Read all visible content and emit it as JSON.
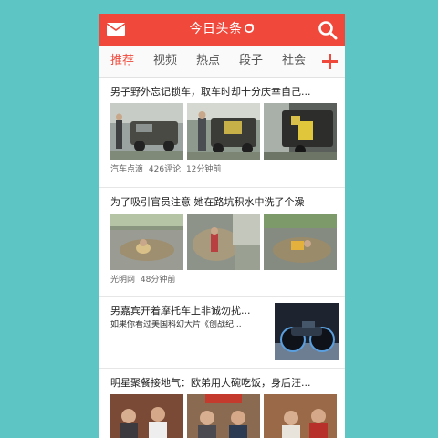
{
  "header": {
    "title": "今日头条",
    "mail_icon": "mail-icon",
    "refresh_icon": "refresh-icon",
    "search_icon": "search-icon",
    "color": "#f0483a"
  },
  "tabs": [
    {
      "label": "推荐",
      "active": true
    },
    {
      "label": "视频",
      "active": false
    },
    {
      "label": "热点",
      "active": false
    },
    {
      "label": "段子",
      "active": false
    },
    {
      "label": "社会",
      "active": false
    }
  ],
  "add_channel_icon": "plus-icon",
  "feed": [
    {
      "title": "男子野外忘记锁车，取车时却十分庆幸自己...",
      "source": "汽车点滴",
      "comments": "426评论",
      "time": "12分钟前",
      "images": [
        "car-photo",
        "car-photo",
        "car-photo"
      ]
    },
    {
      "title": "为了吸引官员注意 她在路坑积水中洗了个澡",
      "source": "光明网",
      "time": "48分钟前",
      "images": [
        "pothole-photo",
        "pothole-photo",
        "pothole-photo"
      ]
    },
    {
      "title": "男嘉宾开着摩托车上非诚勿扰...",
      "subtitle": "如果你看过美国科幻大片《创战纪...",
      "images": [
        "motorcycle-photo"
      ]
    },
    {
      "title": "明星聚餐接地气：欧弟用大碗吃饭，身后汪...",
      "images": [
        "dinner-photo",
        "dinner-photo",
        "dinner-photo"
      ]
    }
  ]
}
